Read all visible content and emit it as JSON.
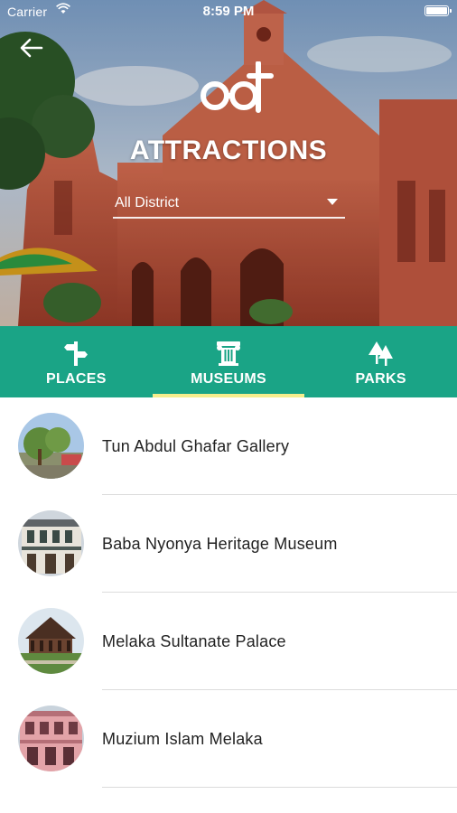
{
  "status_bar": {
    "carrier": "Carrier",
    "time": "8:59 PM"
  },
  "header": {
    "title": "ATTRACTIONS",
    "district_filter": {
      "selected": "All District"
    }
  },
  "tabs": [
    {
      "label": "PLACES",
      "icon": "signpost-icon",
      "active": false
    },
    {
      "label": "MUSEUMS",
      "icon": "museum-column-icon",
      "active": true
    },
    {
      "label": "PARKS",
      "icon": "trees-icon",
      "active": false
    }
  ],
  "list": {
    "items": [
      {
        "name": "Tun Abdul Ghafar Gallery",
        "thumbnail": "gallery-tree-photo"
      },
      {
        "name": "Baba Nyonya Heritage Museum",
        "thumbnail": "heritage-shophouse-photo"
      },
      {
        "name": "Melaka Sultanate Palace",
        "thumbnail": "wooden-palace-photo"
      },
      {
        "name": "Muzium Islam Melaka",
        "thumbnail": "pink-building-photo"
      }
    ]
  },
  "colors": {
    "tab_bar": "#1aa486",
    "active_indicator": "#f6ee8d",
    "text_primary": "#222222",
    "divider": "#dcdcdc"
  }
}
